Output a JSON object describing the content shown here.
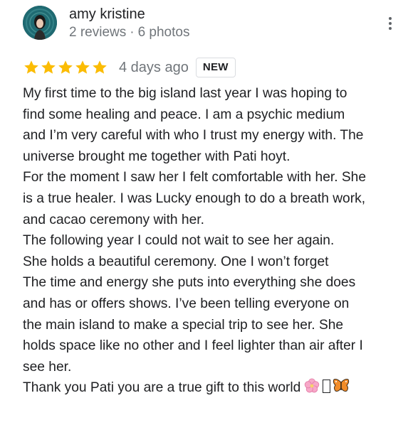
{
  "author": {
    "name": "amy kristine",
    "reviews": "2 reviews",
    "separator": "·",
    "photos": "6 photos",
    "avatar_icon": "profile-photo"
  },
  "review": {
    "rating": 5,
    "rating_max": 5,
    "star_color": "#fbbc04",
    "date": "4 days ago",
    "badge": "NEW",
    "lines": [
      "My first time to the big island last year I was hoping to",
      "find some healing and peace. I am a psychic medium",
      "and I’m very careful with who I trust my energy with. The",
      "universe brought me together with Pati hoyt.",
      "For the moment I saw her I felt comfortable with her. She",
      "is a true healer. I was Lucky enough to do a breath work,",
      "and cacao ceremony with her.",
      "The following year I could not wait to see her again.",
      "She holds a beautiful ceremony. One I won’t forget",
      "The time and energy she puts into everything she does",
      "and has or offers shows. I’ve been telling everyone on",
      "the main island to make a special trip to see her. She",
      "holds space like no other and I feel lighter than air after I",
      "see her.",
      "Thank you Pati you are a true gift to this world"
    ],
    "trailing_icons": [
      "cherry-blossom-icon",
      "missing-glyph-icon",
      "butterfly-icon"
    ]
  },
  "actions": {
    "more_icon": "more-vert-icon"
  }
}
